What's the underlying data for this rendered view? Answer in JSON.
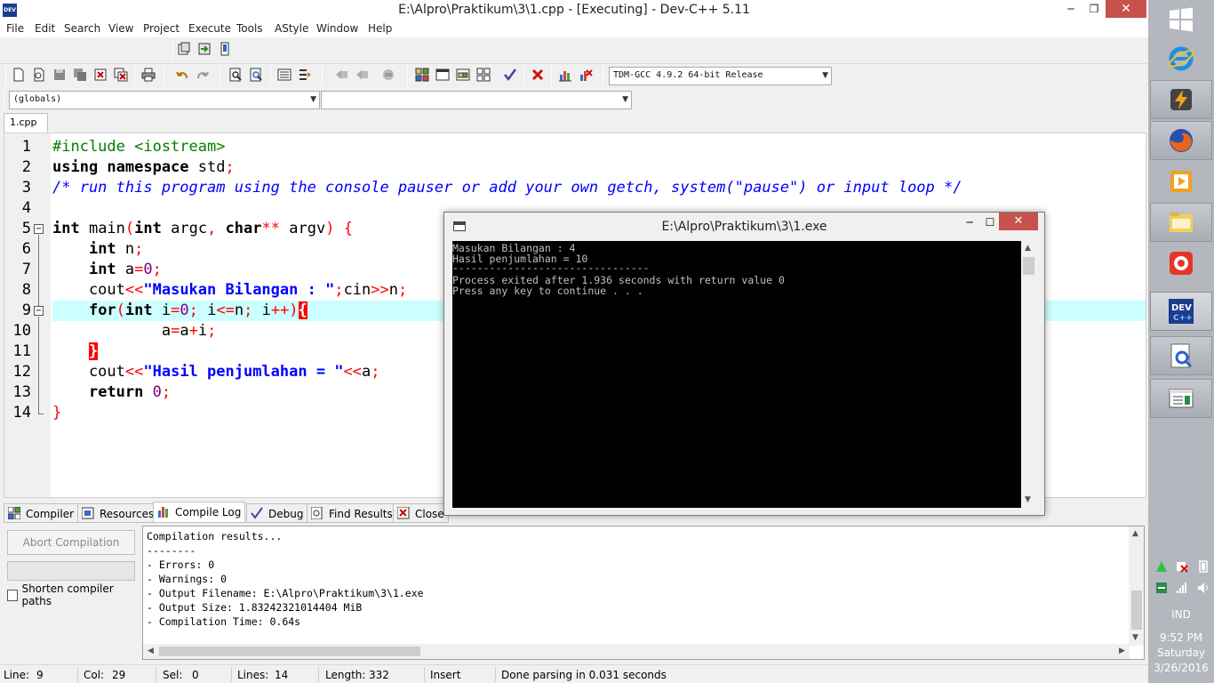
{
  "window": {
    "title": "E:\\Alpro\\Praktikum\\3\\1.cpp - [Executing] - Dev-C++ 5.11",
    "app_icon_text": "DEV",
    "min_glyph": "─",
    "max_glyph": "❐",
    "close_glyph": "✕"
  },
  "menu": [
    "File",
    "Edit",
    "Search",
    "View",
    "Project",
    "Execute",
    "Tools",
    "AStyle",
    "Window",
    "Help"
  ],
  "toolbar": {
    "compiler_select": "TDM-GCC 4.9.2 64-bit Release",
    "scope_select": "(globals)",
    "function_select": ""
  },
  "editor": {
    "tab_label": "1.cpp",
    "line_numbers": [
      "1",
      "2",
      "3",
      "4",
      "5",
      "6",
      "7",
      "8",
      "9",
      "10",
      "11",
      "12",
      "13",
      "14"
    ],
    "active_line": 9
  },
  "bottom_tabs": [
    "Compiler",
    "Resources",
    "Compile Log",
    "Debug",
    "Find Results",
    "Close"
  ],
  "bottom_panel": {
    "abort_label": "Abort Compilation",
    "shorten_label": "Shorten compiler paths",
    "log_lines": [
      "Compilation results...",
      "--------",
      "- Errors: 0",
      "- Warnings: 0",
      "- Output Filename: E:\\Alpro\\Praktikum\\3\\1.exe",
      "- Output Size: 1.83242321014404 MiB",
      "- Compilation Time: 0.64s"
    ]
  },
  "status": {
    "line_label": "Line:",
    "line_value": "9",
    "col_label": "Col:",
    "col_value": "29",
    "sel_label": "Sel:",
    "sel_value": "0",
    "lines_label": "Lines:",
    "lines_value": "14",
    "length_label": "Length:",
    "length_value": "332",
    "mode": "Insert",
    "message": "Done parsing in 0.031 seconds"
  },
  "console": {
    "title": "E:\\Alpro\\Praktikum\\3\\1.exe",
    "min_glyph": "─",
    "max_glyph": "☐",
    "close_glyph": "✕",
    "lines": [
      "Masukan Bilangan : 4",
      "Hasil penjumlahan = 10",
      "--------------------------------",
      "Process exited after 1.936 seconds with return value 0",
      "Press any key to continue . . ."
    ]
  },
  "tray": {
    "language": "IND",
    "time": "9:52 PM",
    "day": "Saturday",
    "date": "3/26/2016"
  },
  "colors": {
    "active_line_bg": "#ccffff",
    "comment": "#0000ff",
    "preprocessor": "#008000",
    "number": "#800080",
    "operator": "#ff0000",
    "close_button": "#c7514b"
  }
}
